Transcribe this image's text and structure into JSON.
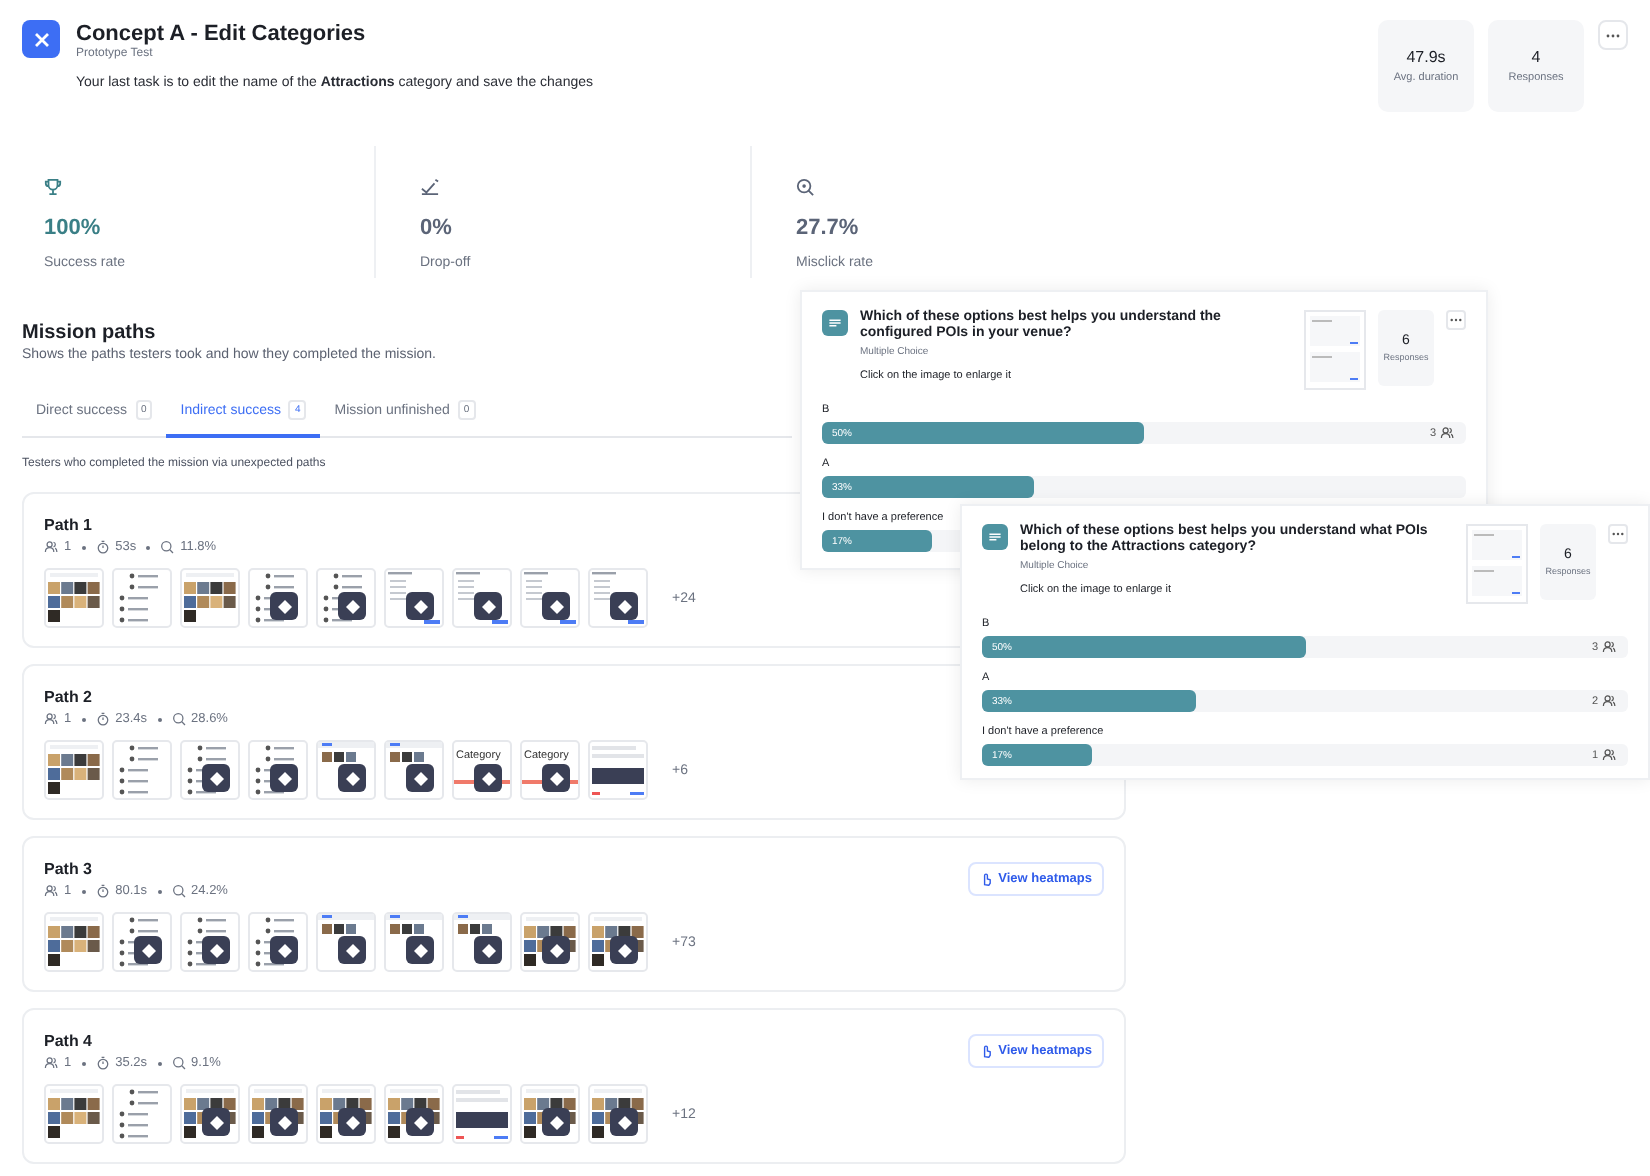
{
  "header": {
    "title": "Concept A - Edit Categories",
    "subtitle": "Prototype Test",
    "task": "Your last task is to edit the name of the **Attractions** category and save the changes",
    "stats": [
      {
        "value": "47.9s",
        "label": "Avg. duration"
      },
      {
        "value": "4",
        "label": "Responses"
      }
    ]
  },
  "metrics": [
    {
      "kind": "success",
      "value": "100%",
      "label": "Success rate"
    },
    {
      "kind": "dropoff",
      "value": "0%",
      "label": "Drop-off"
    },
    {
      "kind": "misclick",
      "value": "27.7%",
      "label": "Misclick rate"
    }
  ],
  "mission": {
    "title": "Mission paths",
    "subtitle": "Shows the paths testers took and how they completed the mission.",
    "tabs": [
      {
        "label": "Direct success",
        "count": "0",
        "selected": false
      },
      {
        "label": "Indirect success",
        "count": "4",
        "selected": true
      },
      {
        "label": "Mission unfinished",
        "count": "0",
        "selected": false
      }
    ],
    "note": "Testers who completed the mission via unexpected paths",
    "paths": [
      {
        "title": "Path 1",
        "testers": "1",
        "time": "53s",
        "misclick": "11.8%",
        "more": "+24",
        "steps": [
          {
            "kind": "photos",
            "marked": false
          },
          {
            "kind": "list",
            "marked": false
          },
          {
            "kind": "photos",
            "marked": false
          },
          {
            "kind": "list",
            "marked": true
          },
          {
            "kind": "list",
            "marked": true
          },
          {
            "kind": "form",
            "marked": true
          },
          {
            "kind": "form",
            "marked": true
          },
          {
            "kind": "form",
            "marked": true
          },
          {
            "kind": "form",
            "marked": true
          }
        ]
      },
      {
        "title": "Path 2",
        "testers": "1",
        "time": "23.4s",
        "misclick": "28.6%",
        "more": "+6",
        "steps": [
          {
            "kind": "photos",
            "marked": false
          },
          {
            "kind": "list",
            "marked": false
          },
          {
            "kind": "list",
            "marked": true
          },
          {
            "kind": "list",
            "marked": true
          },
          {
            "kind": "sparse",
            "marked": true
          },
          {
            "kind": "sparse",
            "marked": true
          },
          {
            "kind": "category",
            "caption": "Category",
            "marked": true
          },
          {
            "kind": "category",
            "caption": "Category",
            "marked": true
          },
          {
            "kind": "keyboard",
            "marked": false
          }
        ]
      },
      {
        "title": "Path 3",
        "testers": "1",
        "time": "80.1s",
        "misclick": "24.2%",
        "more": "+73",
        "heatmaps": "View heatmaps",
        "steps": [
          {
            "kind": "photos",
            "marked": false
          },
          {
            "kind": "list",
            "marked": true
          },
          {
            "kind": "list",
            "marked": true
          },
          {
            "kind": "list",
            "marked": true
          },
          {
            "kind": "sparse",
            "marked": true
          },
          {
            "kind": "sparse",
            "marked": true
          },
          {
            "kind": "sparse",
            "marked": true
          },
          {
            "kind": "photos",
            "marked": true
          },
          {
            "kind": "photos",
            "marked": true
          }
        ]
      },
      {
        "title": "Path 4",
        "testers": "1",
        "time": "35.2s",
        "misclick": "9.1%",
        "more": "+12",
        "heatmaps": "View heatmaps",
        "steps": [
          {
            "kind": "photos",
            "marked": false
          },
          {
            "kind": "list",
            "marked": false
          },
          {
            "kind": "photos",
            "marked": true
          },
          {
            "kind": "photos",
            "marked": true
          },
          {
            "kind": "photos",
            "marked": true
          },
          {
            "kind": "photos",
            "marked": true
          },
          {
            "kind": "keyboard",
            "marked": false
          },
          {
            "kind": "photos",
            "marked": true
          },
          {
            "kind": "photos",
            "marked": true
          }
        ]
      }
    ]
  },
  "questions": [
    {
      "title": "Which of these options best helps you understand the configured POIs in your venue?",
      "type": "Multiple Choice",
      "hint": "Click on the image to enlarge it",
      "responses": "6",
      "responses_label": "Responses",
      "options": [
        {
          "label": "B",
          "percent": "50%",
          "level": 0.5,
          "count": "3"
        },
        {
          "label": "A",
          "percent": "33%",
          "level": 0.33
        },
        {
          "label": "I don't have a preference",
          "percent": "17%",
          "level": 0.17
        }
      ]
    },
    {
      "title": "Which of these options best helps you understand what POIs belong to the Attractions category?",
      "type": "Multiple Choice",
      "hint": "Click on the image to enlarge it",
      "responses": "6",
      "responses_label": "Responses",
      "options": [
        {
          "label": "B",
          "percent": "50%",
          "level": 0.5,
          "count": "3"
        },
        {
          "label": "A",
          "percent": "33%",
          "level": 0.33,
          "count": "2"
        },
        {
          "label": "I don't have a preference",
          "percent": "17%",
          "level": 0.17,
          "count": "1"
        }
      ]
    }
  ]
}
